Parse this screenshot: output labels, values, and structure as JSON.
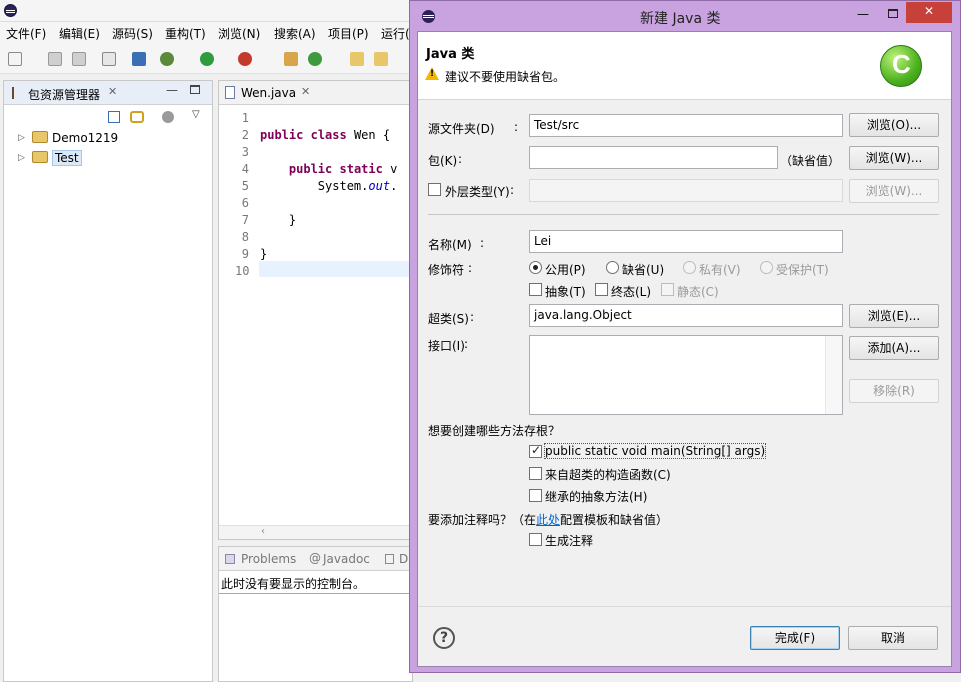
{
  "menu": [
    "文件(F)",
    "编辑(E)",
    "源码(S)",
    "重构(T)",
    "浏览(N)",
    "搜索(A)",
    "项目(P)",
    "运行("
  ],
  "package_explorer": {
    "tab_label": "包资源管理器",
    "projects": [
      "Demo1219",
      "Test"
    ]
  },
  "editor": {
    "tab_label": "Wen.java",
    "lines": [
      {
        "num": "1",
        "text": ""
      },
      {
        "num": "2",
        "text": "public class Wen {"
      },
      {
        "num": "3",
        "text": ""
      },
      {
        "num": "4",
        "text": "    public static v"
      },
      {
        "num": "5",
        "text": "        System.out."
      },
      {
        "num": "6",
        "text": ""
      },
      {
        "num": "7",
        "text": "    }"
      },
      {
        "num": "8",
        "text": ""
      },
      {
        "num": "9",
        "text": "}"
      },
      {
        "num": "10",
        "text": ""
      }
    ]
  },
  "console": {
    "tabs": [
      "Problems",
      "Javadoc",
      "D"
    ],
    "message": "此时没有要显示的控制台。"
  },
  "dialog": {
    "title": "新建 Java 类",
    "banner_title": "Java 类",
    "banner_warning": "建议不要使用缺省包。",
    "source_folder_label": "源文件夹(D)",
    "source_folder_value": "Test/src",
    "package_label": "包(K)",
    "package_value": "",
    "package_default_hint": "（缺省值）",
    "enclosing_type_label": "外层类型(Y)",
    "name_label": "名称(M)",
    "name_value": "Lei",
    "modifiers_label": "修饰符",
    "modifier_public": "公用(P)",
    "modifier_default": "缺省(U)",
    "modifier_private": "私有(V)",
    "modifier_protected": "受保护(T)",
    "modifier_abstract": "抽象(T)",
    "modifier_final": "终态(L)",
    "modifier_static": "静态(C)",
    "superclass_label": "超类(S)",
    "superclass_value": "java.lang.Object",
    "interfaces_label": "接口(I)",
    "stubs_question": "想要创建哪些方法存根？",
    "stub_main": "public static void main(String[] args)",
    "stub_constructors": "来自超类的构造函数(C)",
    "stub_abstract": "继承的抽象方法(H)",
    "comments_prefix": "要添加注释吗？（在",
    "comments_link": "此处",
    "comments_suffix": "配置模板和缺省值）",
    "generate_comments": "生成注释",
    "browse_o": "浏览(O)...",
    "browse_w": "浏览(W)...",
    "browse_w2": "浏览(W)...",
    "browse_e": "浏览(E)...",
    "add_a": "添加(A)...",
    "remove_r": "移除(R)",
    "finish": "完成(F)",
    "cancel": "取消",
    "stub_main_checked": true,
    "modifier_selected": "public",
    "colors": {
      "frame": "#c9a3e0",
      "link": "#0066cc",
      "accent": "#3c7fb1"
    }
  }
}
